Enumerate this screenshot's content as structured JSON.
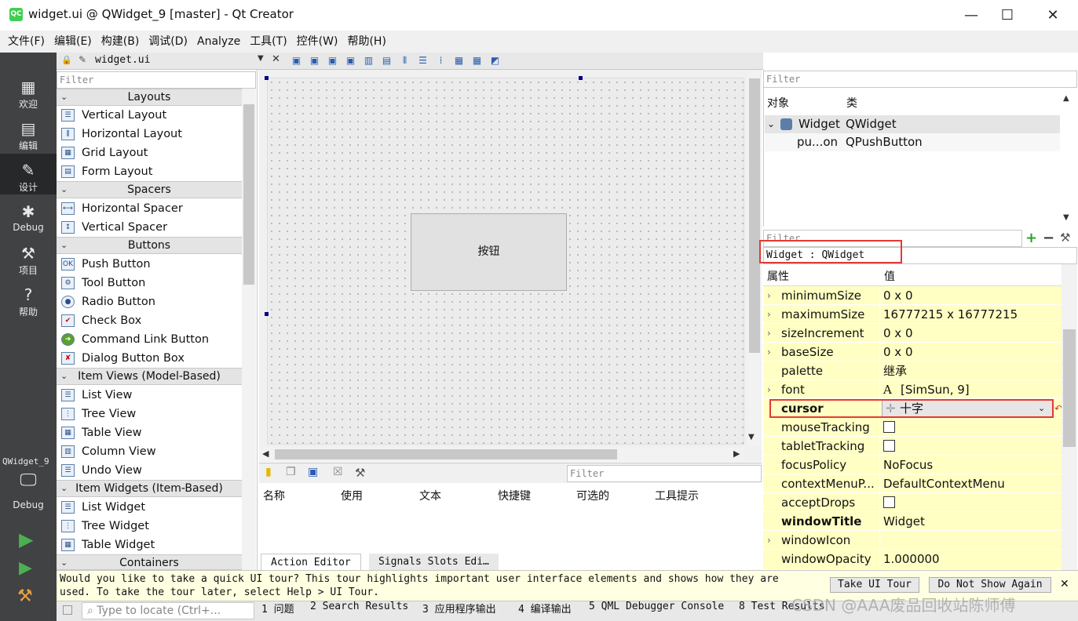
{
  "window": {
    "title": "widget.ui @ QWidget_9 [master] - Qt Creator",
    "logo": "QC",
    "minimize": "—",
    "maximize": "☐",
    "close": "✕"
  },
  "menu": [
    "文件(F)",
    "编辑(E)",
    "构建(B)",
    "调试(D)",
    "Analyze",
    "工具(T)",
    "控件(W)",
    "帮助(H)"
  ],
  "modes": [
    {
      "label": "欢迎",
      "icon": "grid-icon"
    },
    {
      "label": "编辑",
      "icon": "document-icon"
    },
    {
      "label": "设计",
      "icon": "pencil-icon"
    },
    {
      "label": "Debug",
      "icon": "bug-icon"
    },
    {
      "label": "项目",
      "icon": "wrench-icon"
    },
    {
      "label": "帮助",
      "icon": "help-icon"
    }
  ],
  "kit": {
    "project": "QWidget_9",
    "config": "Debug"
  },
  "editor": {
    "document": "widget.ui"
  },
  "widgetbox": {
    "filter_placeholder": "Filter",
    "categories": {
      "layouts": "Layouts",
      "spacers": "Spacers",
      "buttons": "Buttons",
      "item_views": "Item Views (Model-Based)",
      "item_widgets": "Item Widgets (Item-Based)",
      "containers": "Containers"
    },
    "layouts": [
      "Vertical Layout",
      "Horizontal Layout",
      "Grid Layout",
      "Form Layout"
    ],
    "spacers": [
      "Horizontal Spacer",
      "Vertical Spacer"
    ],
    "buttons": [
      "Push Button",
      "Tool Button",
      "Radio Button",
      "Check Box",
      "Command Link Button",
      "Dialog Button Box"
    ],
    "item_views": [
      "List View",
      "Tree View",
      "Table View",
      "Column View",
      "Undo View"
    ],
    "item_widgets": [
      "List Widget",
      "Tree Widget",
      "Table Widget"
    ]
  },
  "form": {
    "button_text": "按钮"
  },
  "action_editor": {
    "filter_placeholder": "Filter",
    "columns": [
      "名称",
      "使用",
      "文本",
      "快捷键",
      "可选的",
      "工具提示"
    ],
    "tabs": [
      "Action Editor",
      "Signals  Slots Edi…"
    ]
  },
  "object_inspector": {
    "filter_placeholder": "Filter",
    "headers": [
      "对象",
      "类"
    ],
    "rows": [
      {
        "object": "Widget",
        "class": "QWidget"
      },
      {
        "object": "pu...on",
        "class": "QPushButton"
      }
    ]
  },
  "property_editor": {
    "filter_placeholder": "Filter",
    "context": "Widget : QWidget",
    "headers": [
      "属性",
      "值"
    ],
    "properties": [
      {
        "name": "minimumSize",
        "value": "0 x 0",
        "expandable": true
      },
      {
        "name": "maximumSize",
        "value": "16777215 x 16777215",
        "expandable": true
      },
      {
        "name": "sizeIncrement",
        "value": "0 x 0",
        "expandable": true
      },
      {
        "name": "baseSize",
        "value": "0 x 0",
        "expandable": true
      },
      {
        "name": "palette",
        "value": "继承"
      },
      {
        "name": "font",
        "value": "[SimSun, 9]",
        "expandable": true
      },
      {
        "name": "cursor",
        "value": "十字",
        "bold": true
      },
      {
        "name": "mouseTracking",
        "checkbox": true
      },
      {
        "name": "tabletTracking",
        "checkbox": true
      },
      {
        "name": "focusPolicy",
        "value": "NoFocus"
      },
      {
        "name": "contextMenuP...",
        "value": "DefaultContextMenu"
      },
      {
        "name": "acceptDrops",
        "checkbox": true
      },
      {
        "name": "windowTitle",
        "value": "Widget",
        "bold": true
      },
      {
        "name": "windowIcon",
        "value": "",
        "expandable": true
      },
      {
        "name": "windowOpacity",
        "value": "1.000000"
      }
    ]
  },
  "tour": {
    "line1": "Would you like to take a quick UI tour? This tour highlights important user interface elements and shows how they are",
    "line2": "used. To take the tour later, select Help > UI Tour.",
    "take_tour": "Take UI Tour",
    "dont_show": "Do Not Show Again"
  },
  "status": {
    "locate_placeholder": "Type to locate (Ctrl+...",
    "tabs": [
      "1 问题",
      "2 Search Results",
      "3 应用程序输出",
      "4 编译输出",
      "5 QML Debugger Console",
      "8 Test Results"
    ]
  },
  "watermark": "CSDN @AAA废品回收站陈师傅",
  "colors": {
    "modebar": "#404244",
    "property_row": "#ffffc4",
    "highlight_box": "#e53935",
    "tour_bar": "#ffffe1"
  }
}
